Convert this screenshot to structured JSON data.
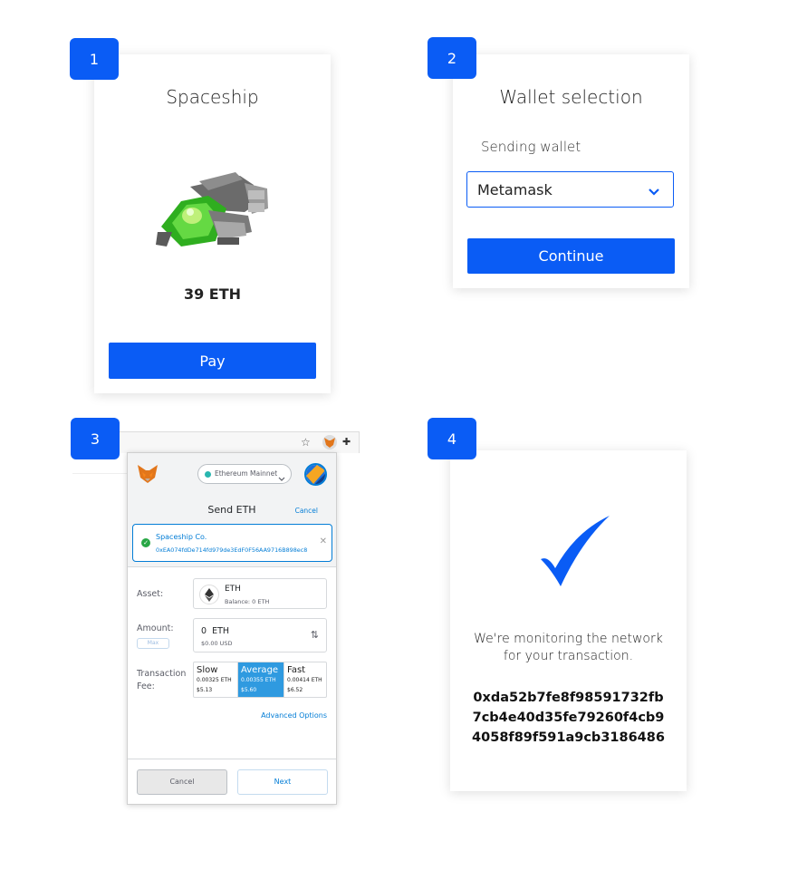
{
  "steps": {
    "s1": "1",
    "s2": "2",
    "s3": "3",
    "s4": "4"
  },
  "panel1": {
    "title": "Spaceship",
    "price": "39 ETH",
    "pay_label": "Pay"
  },
  "panel2": {
    "title": "Wallet selection",
    "field_label": "Sending wallet",
    "selected_wallet": "Metamask",
    "continue_label": "Continue"
  },
  "panel3": {
    "network": "Ethereum Mainnet",
    "header": "Send ETH",
    "cancel_link": "Cancel",
    "recipient_name": "Spaceship Co.",
    "recipient_address": "0xEA074fdDe714fd979de3EdF0F56AA9716B898ec8",
    "asset_label": "Asset:",
    "asset_name": "ETH",
    "asset_balance": "Balance: 0 ETH",
    "amount_label": "Amount:",
    "max_label": "Max",
    "amount_value": "0  ETH",
    "amount_usd": "$0.00 USD",
    "fee_label_1": "Transaction",
    "fee_label_2": "Fee:",
    "fees": [
      {
        "name": "Slow",
        "eth": "0.00325 ETH",
        "usd": "$5.13"
      },
      {
        "name": "Average",
        "eth": "0.00355 ETH",
        "usd": "$5.60"
      },
      {
        "name": "Fast",
        "eth": "0.00414 ETH",
        "usd": "$6.52"
      }
    ],
    "advanced_options": "Advanced Options",
    "cancel_button": "Cancel",
    "next_button": "Next"
  },
  "panel4": {
    "message_line1": "We're monitoring the network",
    "message_line2": "for your transaction.",
    "tx_line1": "0xda52b7fe8f98591732fb",
    "tx_line2": "7cb4e40d35fe79260f4cb9",
    "tx_line3": "4058f89f591a9cb3186486"
  },
  "colors": {
    "accent": "#0a5cf5",
    "metamask_blue": "#037dd6",
    "metamask_selected": "#2f9ae0",
    "success_green": "#28a745"
  },
  "icons": {
    "check": "check-icon",
    "dropdown": "chevron-down-icon",
    "fox": "metamask-fox-icon",
    "star": "star-icon",
    "puzzle": "extension-icon"
  }
}
